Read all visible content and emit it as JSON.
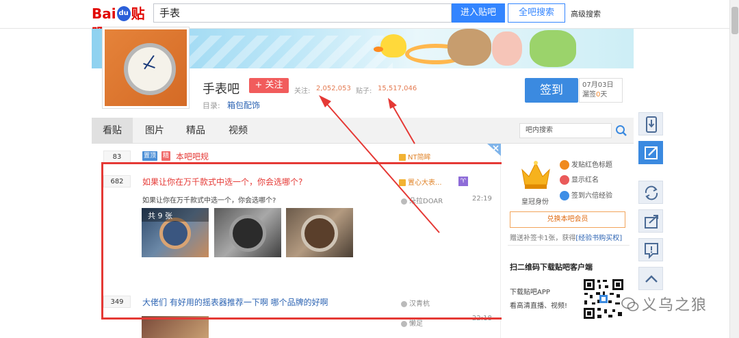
{
  "topbar": {
    "logo_text_left": "Bai",
    "logo_paw": "du",
    "logo_text_right": "贴吧",
    "search_value": "手表",
    "enter_button": "进入贴吧",
    "all_search_button": "全吧搜索",
    "advanced_search": "高级搜索"
  },
  "forum": {
    "name": "手表吧",
    "follow_label": "+ 关注",
    "followers_label": "关注:",
    "followers_value": "2,052,053",
    "posts_label": "贴子:",
    "posts_value": "15,517,046",
    "catalog_label": "目录:",
    "catalog_value": "箱包配饰"
  },
  "signin": {
    "button": "签到",
    "date": "07月03日",
    "missed_prefix": "漏签",
    "missed_count": "0",
    "missed_suffix": "天"
  },
  "nav": {
    "tabs": [
      "看贴",
      "图片",
      "精品",
      "视频"
    ],
    "active": "看贴",
    "search_placeholder": "吧内搜索"
  },
  "threads": [
    {
      "replies": "83",
      "tags": [
        "置顶",
        "精"
      ],
      "title": "本吧吧规",
      "author": "NT简眸"
    },
    {
      "replies": "682",
      "title": "如果让你在万千款式中选一个，你会选哪个?",
      "author": "置心大表...",
      "excerpt": "如果让你在万千款式中选一个，你会选哪个?",
      "last_reply_author": "朵拉DOAR",
      "time": "22:19",
      "image_count_label": "共 9 张"
    },
    {
      "replies": "349",
      "title": "大佬们 有好用的摇表器推荐一下啊 哪个品牌的好啊",
      "author": "汉青杭",
      "time": "22:18",
      "last_reply_author": "懒足"
    }
  ],
  "sidebar": {
    "crown_label": "皇冠身份",
    "perks": [
      "发贴红色标题",
      "显示红名",
      "签到六倍经验"
    ],
    "vip_button": "兑换本吧会员",
    "gift_text": "赠送补签卡1张，获得",
    "gift_link": "[经验书购买权]",
    "qr_title": "扫二维码下载贴吧客户端",
    "qr_sub1": "下载贴吧APP",
    "qr_sub2": "看高清直播、视频!"
  },
  "watermark": "义乌之狼",
  "colors": {
    "accent_blue": "#3385ff",
    "follow_red": "#f15c5c",
    "stat_orange": "#e47b52",
    "highlight_box": "#e53935",
    "title_link": "#2d64b3"
  }
}
